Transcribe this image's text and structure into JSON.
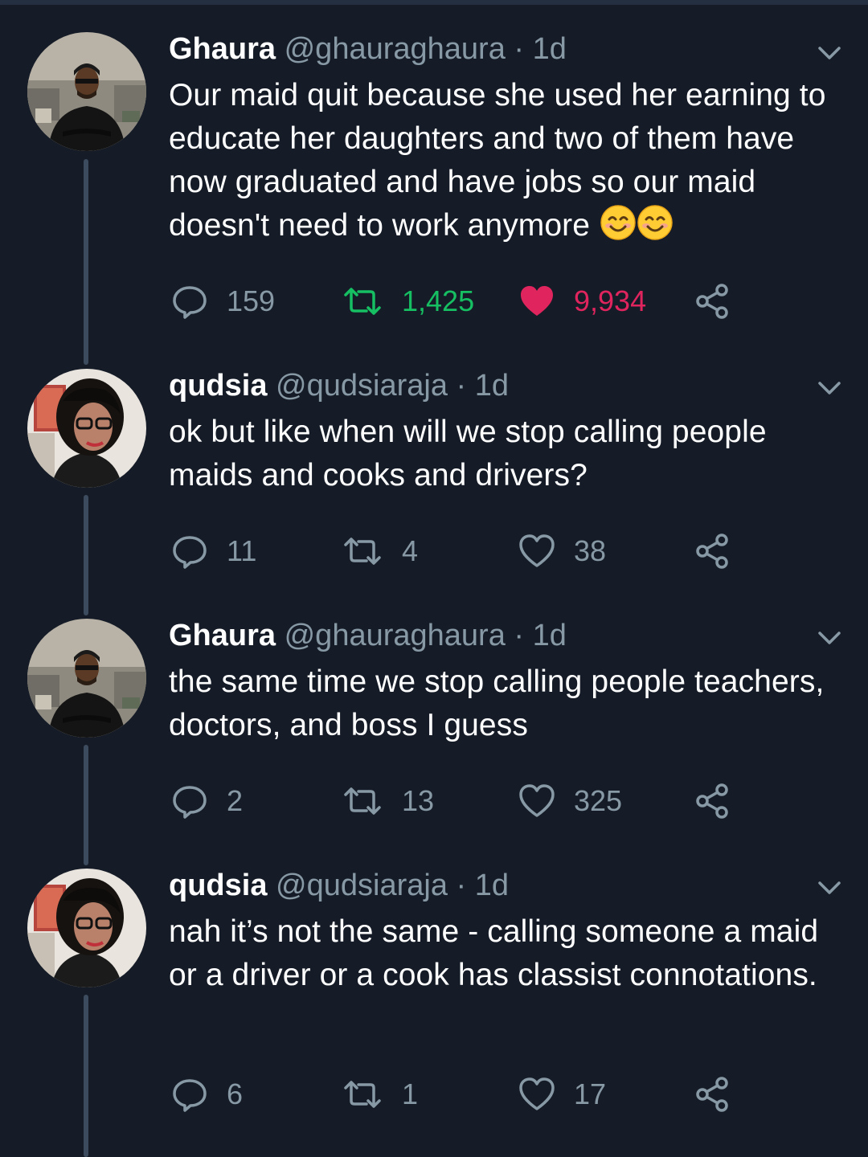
{
  "colors": {
    "background": "#151c27",
    "text_primary": "#ffffff",
    "text_secondary": "#8899a6",
    "retweet_active": "#17bf63",
    "like_active": "#e0245e",
    "thread_line": "#3d4b5e"
  },
  "tweets": [
    {
      "name": "Ghaura",
      "handle_time": "@ghauraghaura · 1d",
      "text": "Our maid quit because she used her earning to educate her daughters and two of them have now graduated and have jobs so our maid doesn't need to work anymore",
      "emoji": [
        "smiling-face-icon",
        "smiling-face-icon"
      ],
      "replies": "159",
      "retweets": "1,425",
      "likes": "9,934",
      "retweeted": true,
      "liked": true
    },
    {
      "name": "qudsia",
      "handle_time": "@qudsiaraja · 1d",
      "text": "ok but like when will we stop calling people maids and cooks and drivers?",
      "replies": "11",
      "retweets": "4",
      "likes": "38",
      "retweeted": false,
      "liked": false
    },
    {
      "name": "Ghaura",
      "handle_time": "@ghauraghaura · 1d",
      "text": "the same time we stop calling people teachers, doctors, and boss I guess",
      "replies": "2",
      "retweets": "13",
      "likes": "325",
      "retweeted": false,
      "liked": false
    },
    {
      "name": "qudsia",
      "handle_time": "@qudsiaraja · 1d",
      "text": "nah it’s not the same - calling someone a maid or a driver or a cook has classist connotations.",
      "replies": "6",
      "retweets": "1",
      "likes": "17",
      "retweeted": false,
      "liked": false
    }
  ]
}
